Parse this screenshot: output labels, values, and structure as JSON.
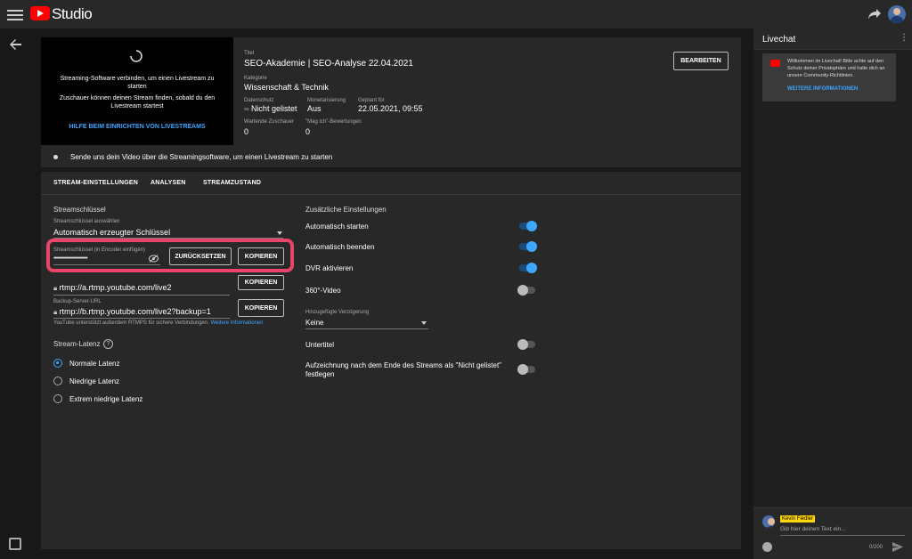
{
  "header": {
    "app_title": "Studio"
  },
  "preview": {
    "line1": "Streaming-Software verbinden, um einen Livestream zu starten",
    "line2": "Zuschauer können deinen Stream finden, sobald du den Livestream startest",
    "help_link": "HILFE BEIM EINRICHTEN VON LIVESTREAMS"
  },
  "info": {
    "title_label": "Titel",
    "title": "SEO-Akademie | SEO-Analyse 22.04.2021",
    "category_label": "Kategorie",
    "category": "Wissenschaft & Technik",
    "privacy_label": "Datenschutz",
    "privacy": "Nicht gelistet",
    "monetization_label": "Monetarisierung",
    "monetization": "Aus",
    "scheduled_label": "Geplant für",
    "scheduled": "22.05.2021, 09:55",
    "waiting_label": "Wartende Zuschauer",
    "waiting": "0",
    "likes_label": "\"Mag ich\"-Bewertungen",
    "likes": "0",
    "edit_button": "BEARBEITEN"
  },
  "step_text": "Sende uns dein Video über die Streamingsoftware, um einen Livestream zu starten",
  "tabs": [
    "STREAM-EINSTELLUNGEN",
    "ANALYSEN",
    "STREAMZUSTAND"
  ],
  "stream": {
    "section_title": "Streamschlüssel",
    "key_select_label": "Streamschlüssel auswählen",
    "key_select_value": "Automatisch erzeugter Schlüssel",
    "key_field_label": "Streamschlüssel (in Encoder einfügen)",
    "key_value": "••••••••••••••••••••••••••",
    "reset_button": "ZURÜCKSETZEN",
    "copy_button": "KOPIEREN",
    "url_value": "rtmp://a.rtmp.youtube.com/live2",
    "backup_label": "Backup-Server-URL",
    "backup_value": "rtmp://b.rtmp.youtube.com/live2?backup=1",
    "rtmps_note": "YouTube unterstützt außerdem RTMPS für sichere Verbindungen.",
    "rtmps_link": "Weitere Informationen",
    "latency_title": "Stream-Latenz",
    "latency_options": [
      "Normale Latenz",
      "Niedrige Latenz",
      "Extrem niedrige Latenz"
    ]
  },
  "extra": {
    "title": "Zusätzliche Einstellungen",
    "auto_start": "Automatisch starten",
    "auto_stop": "Automatisch beenden",
    "dvr": "DVR aktivieren",
    "video360": "360°-Video",
    "delay_label": "Hinzugefügte Verzögerung",
    "delay_value": "Keine",
    "subtitles": "Untertitel",
    "record_line1": "Aufzeichnung nach dem Ende des Streams als \"Nicht gelistet\"",
    "record_line2": "festlegen"
  },
  "toggles": {
    "auto_start": true,
    "auto_stop": true,
    "dvr": true,
    "video360": false,
    "subtitles": false,
    "record": false
  },
  "latency_selected": 0,
  "chat": {
    "title": "Livechat",
    "welcome": "Willkommen im Livechat! Bitte achte auf den Schutz deiner Privatsphäre und halte dich an unsere Community-Richtlinien.",
    "more_info": "WEITERE INFORMATIONEN",
    "user": "Kevin Fiedler",
    "placeholder": "Gib hier deinen Text ein...",
    "counter": "0/200"
  },
  "colors": {
    "accent": "#3ea6ff",
    "brand": "#ff0000",
    "highlight": "#e8456a",
    "username_bg": "#ffd600"
  }
}
